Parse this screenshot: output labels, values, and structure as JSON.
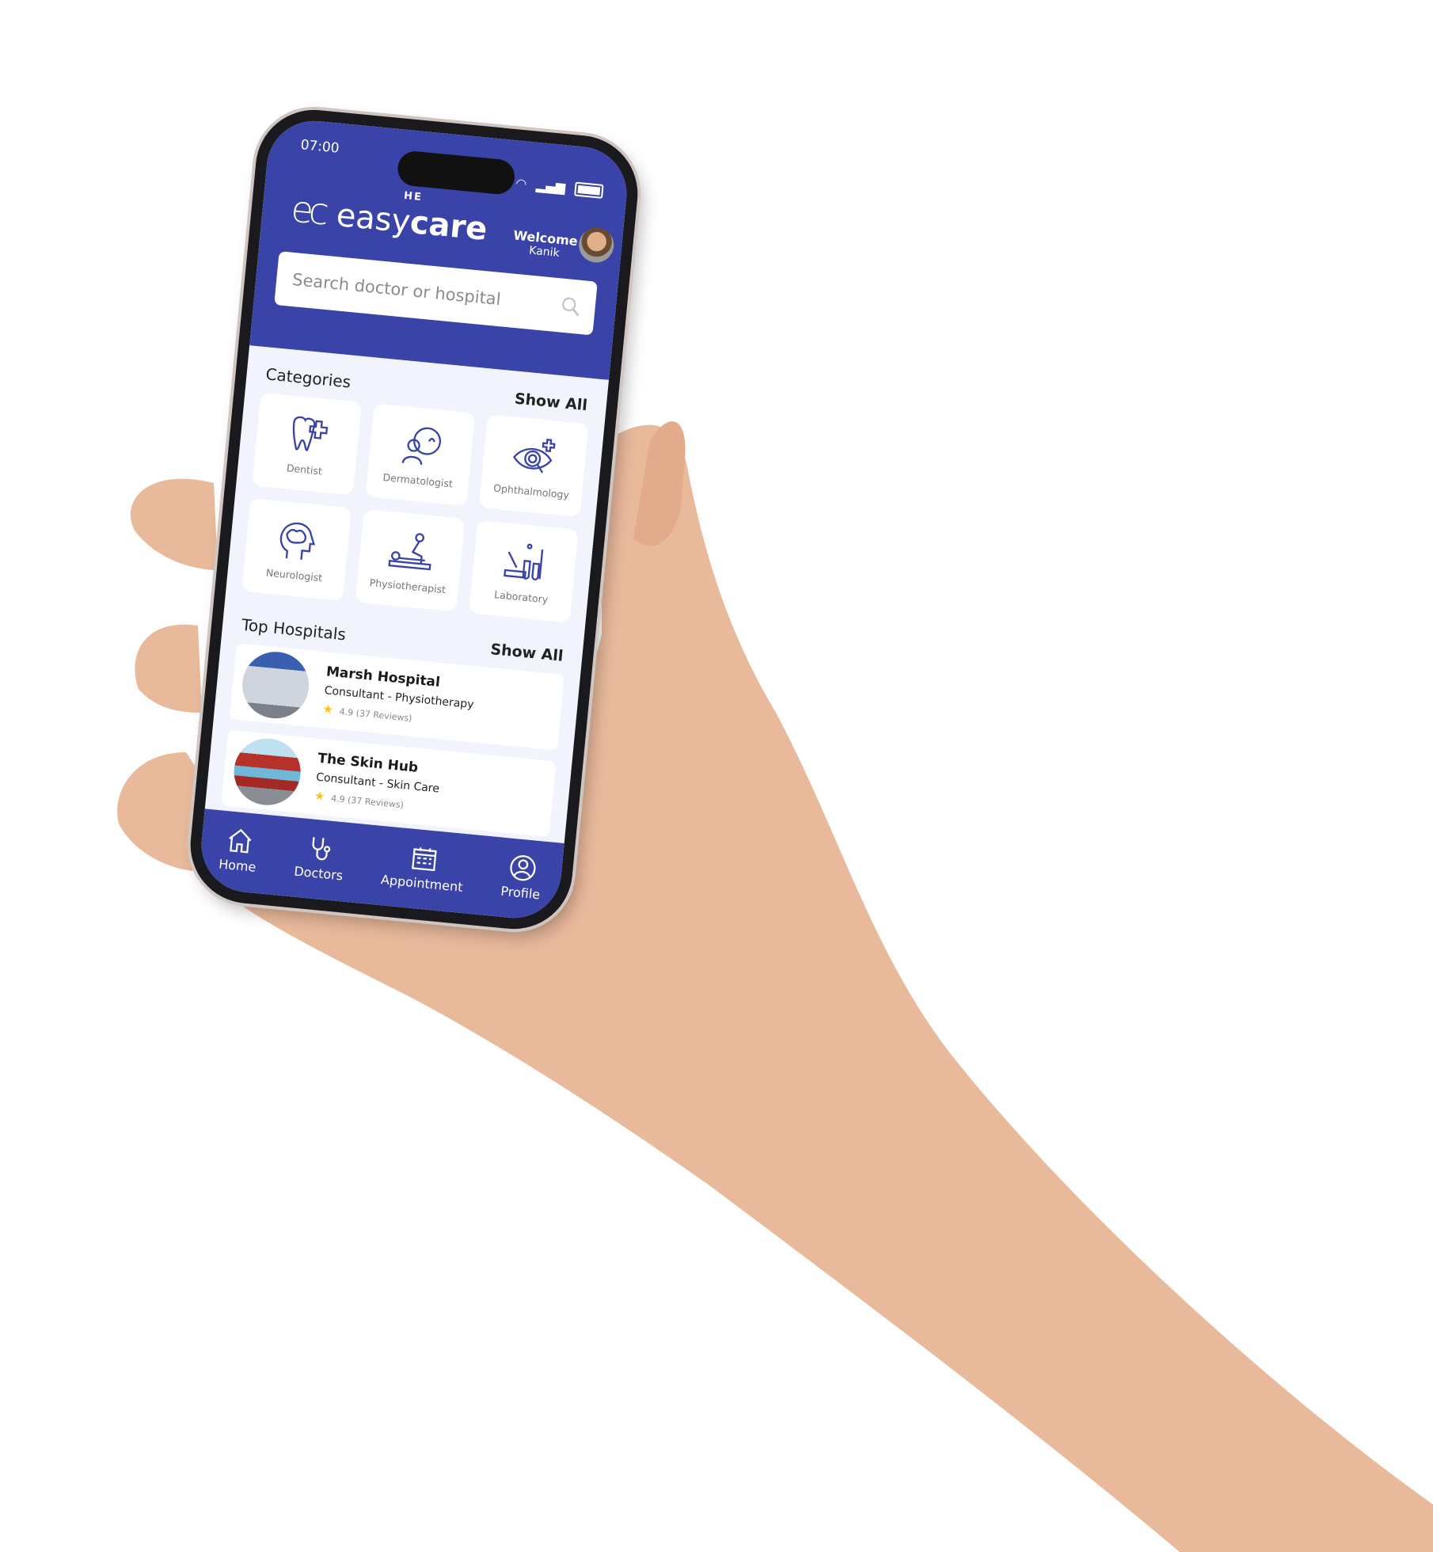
{
  "colors": {
    "primary": "#3a43a8",
    "background": "#f1f4fd",
    "star": "#f7c51e",
    "skin": "#e9b99b"
  },
  "status": {
    "time": "07:00",
    "icons": [
      "wifi-icon",
      "signal-icon",
      "battery-icon"
    ]
  },
  "header": {
    "logo_the": "HE",
    "logo_ec": "ec",
    "logo_easy": "easy",
    "logo_care": "care",
    "welcome": "Welcome",
    "user_name": "Kanik"
  },
  "search": {
    "placeholder": "Search doctor or hospital",
    "value": ""
  },
  "categories": {
    "title": "Categories",
    "show_all": "Show All",
    "items": [
      {
        "label": "Dentist",
        "icon": "tooth-icon"
      },
      {
        "label": "Dermatologist",
        "icon": "dermatologist-icon"
      },
      {
        "label": "Ophthalmology",
        "icon": "eye-icon"
      },
      {
        "label": "Neurologist",
        "icon": "brain-icon"
      },
      {
        "label": "Physiotherapist",
        "icon": "physiotherapy-icon"
      },
      {
        "label": "Laboratory",
        "icon": "lab-icon"
      }
    ]
  },
  "hospitals": {
    "title": "Top Hospitals",
    "show_all": "Show All",
    "items": [
      {
        "name": "Marsh Hospital",
        "specialty": "Consultant - Physiotherapy",
        "rating": "4.9 (37 Reviews)"
      },
      {
        "name": "The Skin Hub",
        "specialty": "Consultant - Skin Care",
        "rating": "4.9 (37 Reviews)"
      }
    ]
  },
  "nav": {
    "items": [
      {
        "label": "Home",
        "icon": "home-icon"
      },
      {
        "label": "Doctors",
        "icon": "stethoscope-icon"
      },
      {
        "label": "Appointment",
        "icon": "calendar-icon"
      },
      {
        "label": "Profile",
        "icon": "profile-icon"
      }
    ]
  }
}
